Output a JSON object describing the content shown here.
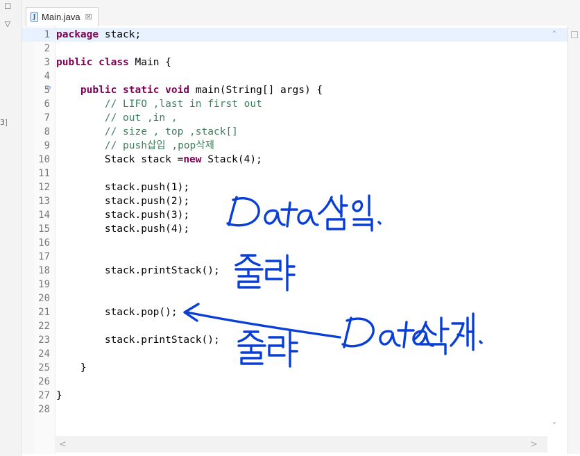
{
  "tab": {
    "title": "Main.java",
    "close_glyph": "☒",
    "icon": "java-file-icon",
    "icon_glyph": "J"
  },
  "left_strip": {
    "minimize_glyph": "☐",
    "menu_glyph": "▽",
    "partial_glyph": "3]"
  },
  "scroll": {
    "up": "˄",
    "down": "˅",
    "left": "<",
    "right": ">"
  },
  "code_lines": [
    {
      "n": "1",
      "tokens": [
        {
          "t": "package",
          "c": "kw"
        },
        {
          "t": " stack;"
        }
      ]
    },
    {
      "n": "2",
      "tokens": []
    },
    {
      "n": "3",
      "tokens": [
        {
          "t": "public",
          "c": "kw"
        },
        {
          "t": " "
        },
        {
          "t": "class",
          "c": "kw"
        },
        {
          "t": " Main {"
        }
      ]
    },
    {
      "n": "4",
      "tokens": []
    },
    {
      "n": "5",
      "tokens": [
        {
          "t": "    "
        },
        {
          "t": "public",
          "c": "kw"
        },
        {
          "t": " "
        },
        {
          "t": "static",
          "c": "kw"
        },
        {
          "t": " "
        },
        {
          "t": "void",
          "c": "kw"
        },
        {
          "t": " main(String[] args) {"
        }
      ]
    },
    {
      "n": "6",
      "tokens": [
        {
          "t": "        "
        },
        {
          "t": "// LIFO ,last in first out",
          "c": "cm"
        }
      ]
    },
    {
      "n": "7",
      "tokens": [
        {
          "t": "        "
        },
        {
          "t": "// out ,in ,",
          "c": "cm"
        }
      ]
    },
    {
      "n": "8",
      "tokens": [
        {
          "t": "        "
        },
        {
          "t": "// size , top ,stack[]",
          "c": "cm"
        }
      ]
    },
    {
      "n": "9",
      "tokens": [
        {
          "t": "        "
        },
        {
          "t": "// push삽입 ,pop삭제",
          "c": "cm"
        }
      ]
    },
    {
      "n": "10",
      "tokens": [
        {
          "t": "        Stack stack ="
        },
        {
          "t": "new",
          "c": "kw"
        },
        {
          "t": " Stack(4);"
        }
      ]
    },
    {
      "n": "11",
      "tokens": []
    },
    {
      "n": "12",
      "tokens": [
        {
          "t": "        stack.push(1);"
        }
      ]
    },
    {
      "n": "13",
      "tokens": [
        {
          "t": "        stack.push(2);"
        }
      ]
    },
    {
      "n": "14",
      "tokens": [
        {
          "t": "        stack.push(3);"
        }
      ]
    },
    {
      "n": "15",
      "tokens": [
        {
          "t": "        stack.push(4);"
        }
      ]
    },
    {
      "n": "16",
      "tokens": []
    },
    {
      "n": "17",
      "tokens": []
    },
    {
      "n": "18",
      "tokens": [
        {
          "t": "        stack.printStack();"
        }
      ]
    },
    {
      "n": "19",
      "tokens": []
    },
    {
      "n": "20",
      "tokens": []
    },
    {
      "n": "21",
      "tokens": [
        {
          "t": "        stack.pop();"
        }
      ]
    },
    {
      "n": "22",
      "tokens": []
    },
    {
      "n": "23",
      "tokens": [
        {
          "t": "        stack.printStack();"
        }
      ]
    },
    {
      "n": "24",
      "tokens": []
    },
    {
      "n": "25",
      "tokens": [
        {
          "t": "    }"
        }
      ]
    },
    {
      "n": "26",
      "tokens": []
    },
    {
      "n": "27",
      "tokens": [
        {
          "t": "}"
        }
      ]
    },
    {
      "n": "28",
      "tokens": []
    }
  ],
  "fold_marker_line": "5",
  "fold_glyph": "⊖",
  "current_line": "1",
  "annotations": [
    {
      "text": "Data 삽입.",
      "kind": "handwriting"
    },
    {
      "text": "출력",
      "kind": "handwriting"
    },
    {
      "text": "Data 삭제.",
      "kind": "handwriting"
    },
    {
      "text": "출력",
      "kind": "handwriting"
    }
  ],
  "ink_color": "#0a3fd6"
}
